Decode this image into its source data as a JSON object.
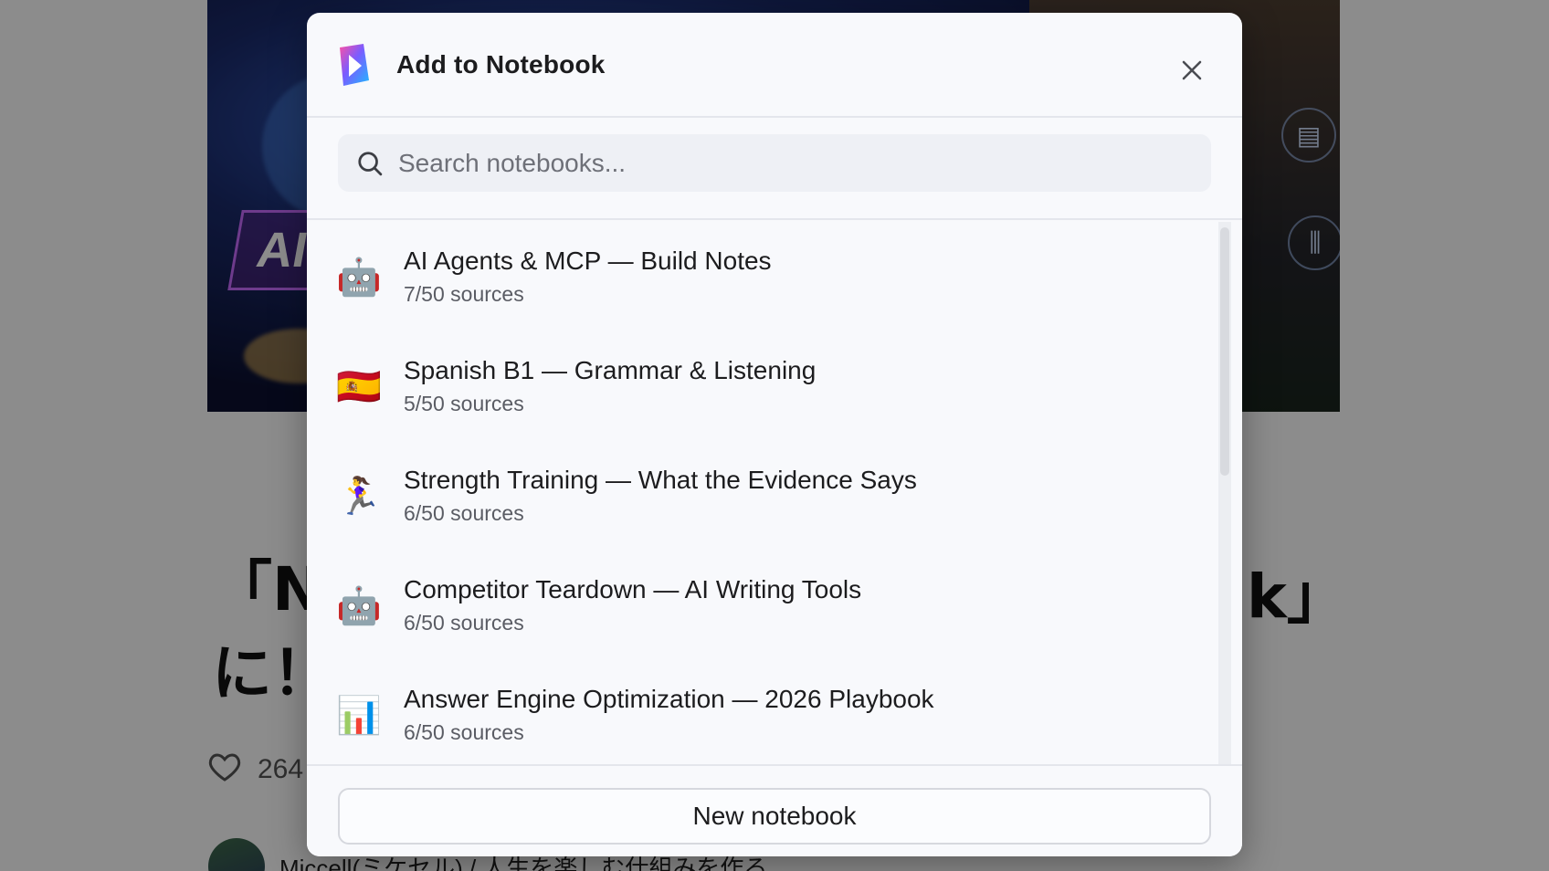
{
  "background": {
    "hero_tag": "AI",
    "title_left_line1": "「No",
    "title_left_line2": "に！",
    "title_right": "k」",
    "like_count": "264",
    "author_name": "Miccell(ミケセル) / 人生を楽しむ仕組みを作る"
  },
  "modal": {
    "title": "Add to Notebook",
    "search": {
      "placeholder": "Search notebooks...",
      "value": ""
    },
    "notebooks": [
      {
        "emoji": "🤖",
        "title": "AI Agents & MCP — Build Notes",
        "sources": "7/50 sources"
      },
      {
        "emoji": "🇪🇸",
        "title": "Spanish B1 — Grammar & Listening",
        "sources": "5/50 sources"
      },
      {
        "emoji": "🏃‍♀️",
        "title": "Strength Training — What the Evidence Says",
        "sources": "6/50 sources"
      },
      {
        "emoji": "🤖",
        "title": "Competitor Teardown — AI Writing Tools",
        "sources": "6/50 sources"
      },
      {
        "emoji": "📊",
        "title": "Answer Engine Optimization — 2026 Playbook",
        "sources": "6/50 sources"
      }
    ],
    "new_notebook_label": "New notebook",
    "colors": {
      "accent_logo_top": "#7b5cff",
      "accent_logo_bottom": "#1fb8ff"
    }
  }
}
